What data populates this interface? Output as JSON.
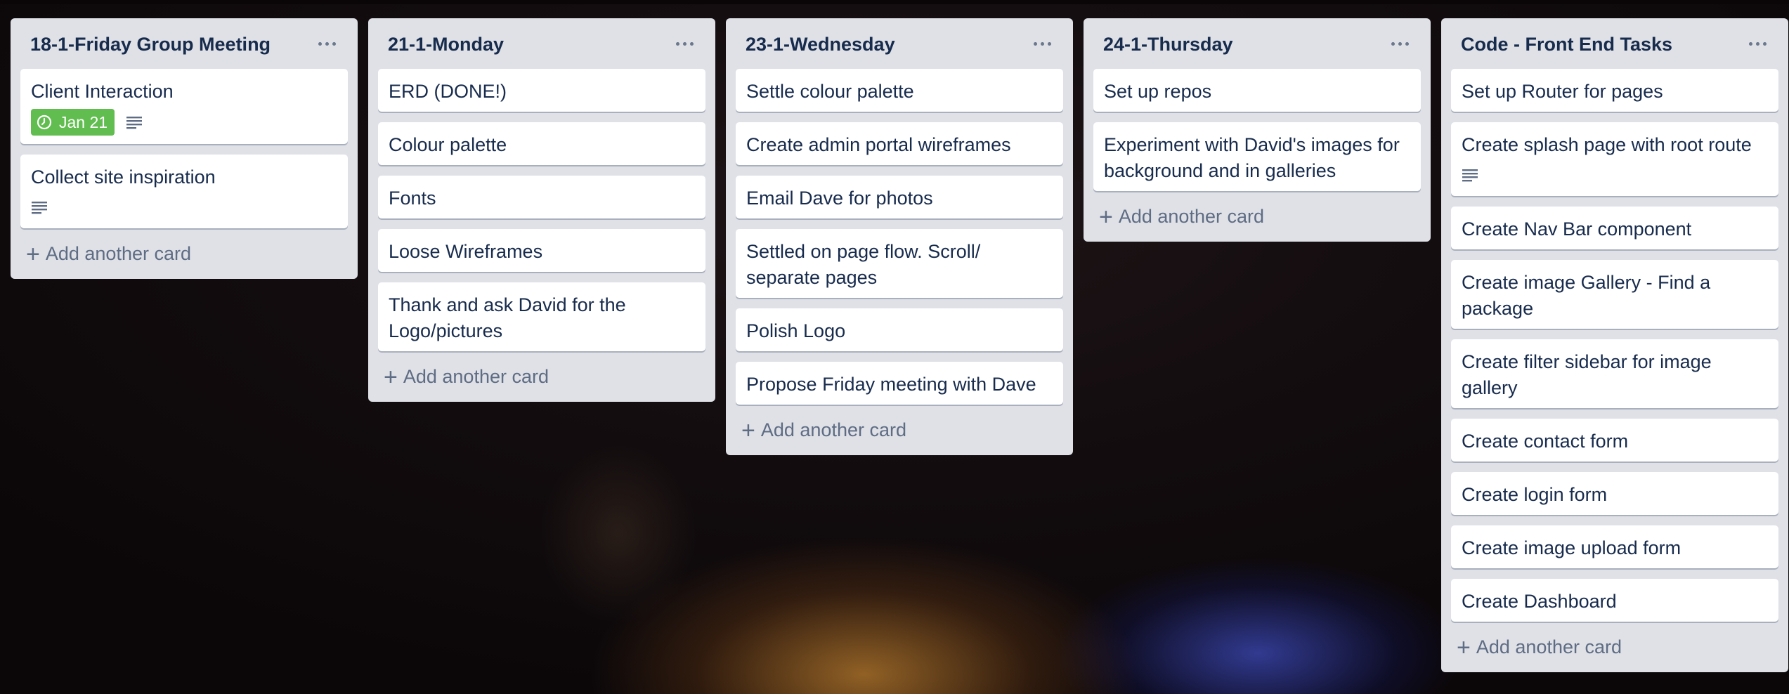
{
  "lists": [
    {
      "title": "18-1-Friday Group Meeting",
      "cards": [
        {
          "text": "Client Interaction",
          "due": "Jan 21",
          "has_description": true
        },
        {
          "text": "Collect site inspiration",
          "has_description": true
        }
      ]
    },
    {
      "title": "21-1-Monday",
      "cards": [
        {
          "text": "ERD (DONE!)"
        },
        {
          "text": "Colour palette"
        },
        {
          "text": "Fonts"
        },
        {
          "text": "Loose Wireframes"
        },
        {
          "text": "Thank and ask David for the Logo/pictures"
        }
      ]
    },
    {
      "title": "23-1-Wednesday",
      "cards": [
        {
          "text": "Settle colour palette"
        },
        {
          "text": "Create admin portal wireframes"
        },
        {
          "text": "Email Dave for photos"
        },
        {
          "text": "Settled on page flow. Scroll/ separate pages"
        },
        {
          "text": "Polish Logo"
        },
        {
          "text": "Propose Friday meeting with Dave"
        }
      ]
    },
    {
      "title": "24-1-Thursday",
      "cards": [
        {
          "text": "Set up repos"
        },
        {
          "text": "Experiment with David's images for background and in galleries"
        }
      ]
    },
    {
      "title": "Code - Front End Tasks",
      "cards": [
        {
          "text": "Set up Router for pages"
        },
        {
          "text": "Create splash page with root route",
          "has_description": true
        },
        {
          "text": "Create Nav Bar component"
        },
        {
          "text": "Create image Gallery - Find a package"
        },
        {
          "text": "Create filter sidebar for image gallery"
        },
        {
          "text": "Create contact form"
        },
        {
          "text": "Create login form"
        },
        {
          "text": "Create image upload form"
        },
        {
          "text": "Create Dashboard"
        }
      ]
    }
  ],
  "add_card_label": "Add another card",
  "colors": {
    "list_bg": "#dfe1e6",
    "title": "#172b4d",
    "due_badge": "#61bd4f",
    "muted": "#5e6c84"
  },
  "icons": {
    "list_menu": "ellipsis-icon",
    "due": "clock-icon",
    "description": "description-lines-icon",
    "add": "plus-icon"
  }
}
